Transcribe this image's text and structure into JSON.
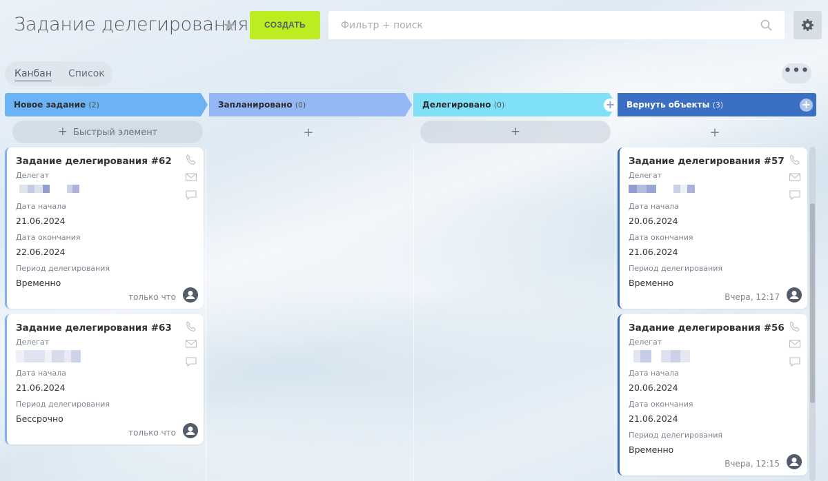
{
  "header": {
    "title": "Задание делегирования",
    "create_label": "СОЗДАТЬ",
    "search_placeholder": "Фильтр + поиск"
  },
  "views": [
    {
      "label": "Канбан",
      "active": true
    },
    {
      "label": "Список",
      "active": false
    }
  ],
  "colors": {
    "create": "#bbed21",
    "col_new": "#6cb3f5",
    "col_planned": "#93b8f5",
    "col_delegated": "#7fe0f7",
    "col_return": "#3b6fc4"
  },
  "columns": [
    {
      "name": "Новое задание",
      "count": "(2)",
      "quick_label": "Быстрый элемент"
    },
    {
      "name": "Запланировано",
      "count": "(0)"
    },
    {
      "name": "Делегировано",
      "count": "(0)"
    },
    {
      "name": "Вернуть объекты",
      "count": "(3)"
    }
  ],
  "cards": {
    "c62": {
      "title": "Задание делегирования #62",
      "delegate_label": "Делегат",
      "f1_label": "Дата начала",
      "f1_value": "21.06.2024",
      "f2_label": "Дата окончания",
      "f2_value": "22.06.2024",
      "f3_label": "Период делегирования",
      "f3_value": "Временно",
      "time": "только что"
    },
    "c63": {
      "title": "Задание делегирования #63",
      "delegate_label": "Делегат",
      "f1_label": "Дата начала",
      "f1_value": "21.06.2024",
      "f3_label": "Период делегирования",
      "f3_value": "Бессрочно",
      "time": "только что"
    },
    "c57": {
      "title": "Задание делегирования #57",
      "delegate_label": "Делегат",
      "f1_label": "Дата начала",
      "f1_value": "20.06.2024",
      "f2_label": "Дата окончания",
      "f2_value": "21.06.2024",
      "f3_label": "Период делегирования",
      "f3_value": "Временно",
      "time": "Вчера, 12:17"
    },
    "c56": {
      "title": "Задание делегирования #56",
      "delegate_label": "Делегат",
      "f1_label": "Дата начала",
      "f1_value": "20.06.2024",
      "f2_label": "Дата окончания",
      "f2_value": "21.06.2024",
      "f3_label": "Период делегирования",
      "f3_value": "Временно",
      "time": "Вчера, 12:15"
    }
  },
  "icons": [
    "star-icon",
    "search-icon",
    "gear-icon",
    "more-icon",
    "plus-icon",
    "phone-icon",
    "mail-icon",
    "chat-icon",
    "user-avatar-icon"
  ]
}
